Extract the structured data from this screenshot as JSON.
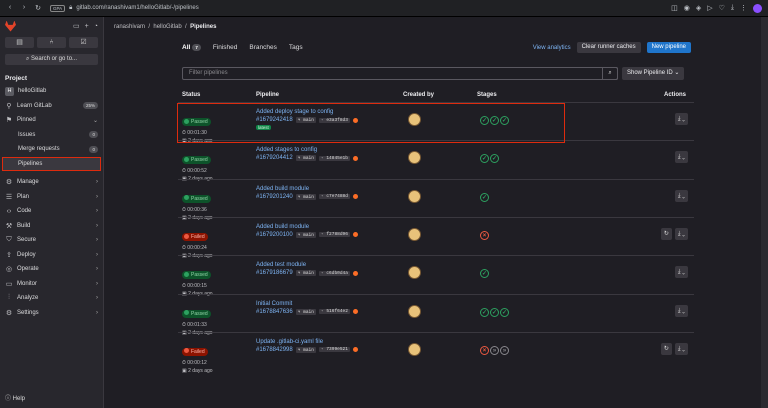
{
  "browser": {
    "security_tag": "GPA",
    "url": "gitlab.com/ranashivam1/helloGitlab/-/pipelines"
  },
  "sidebar": {
    "search": "Search or go to...",
    "section": "Project",
    "project_name": "helloGitlab",
    "project_initial": "H",
    "learn": "Learn GitLab",
    "learn_badge": "25%",
    "pinned": "Pinned",
    "issues": "Issues",
    "issues_count": "0",
    "merge_requests": "Merge requests",
    "mr_count": "0",
    "pipelines": "Pipelines",
    "menu": [
      "Manage",
      "Plan",
      "Code",
      "Build",
      "Secure",
      "Deploy",
      "Operate",
      "Monitor",
      "Analyze",
      "Settings"
    ],
    "help": "Help"
  },
  "breadcrumb": {
    "user": "ranashivam",
    "project": "helloGitlab",
    "page": "Pipelines"
  },
  "tabs": {
    "all": "All",
    "all_count": "7",
    "finished": "Finished",
    "branches": "Branches",
    "tags": "Tags"
  },
  "actions": {
    "analytics": "View analytics",
    "clear": "Clear runner caches",
    "new": "New pipeline"
  },
  "filter": {
    "placeholder": "Filter pipelines",
    "show_id": "Show Pipeline ID"
  },
  "columns": {
    "status": "Status",
    "pipeline": "Pipeline",
    "created_by": "Created by",
    "stages": "Stages",
    "actions": "Actions"
  },
  "rows": [
    {
      "status": "Passed",
      "duration": "00:01:30",
      "ago": "2 days ago",
      "title": "Added deploy stage to config",
      "id": "#1679242418",
      "branch": "main",
      "commit": "e3a3f8d3",
      "latest": "latest"
    },
    {
      "status": "Passed",
      "duration": "00:00:52",
      "ago": "2 days ago",
      "title": "Added stages to config",
      "id": "#1679204412",
      "branch": "main",
      "commit": "14845e1b"
    },
    {
      "status": "Passed",
      "duration": "00:00:36",
      "ago": "2 days ago",
      "title": "Added build module",
      "id": "#1679201240",
      "branch": "main",
      "commit": "c7e7488d"
    },
    {
      "status": "Failed",
      "duration": "00:00:24",
      "ago": "2 days ago",
      "title": "Added build module",
      "id": "#1679200100",
      "branch": "main",
      "commit": "f2788d96"
    },
    {
      "status": "Passed",
      "duration": "00:00:15",
      "ago": "2 days ago",
      "title": "Added test module",
      "id": "#1679186679",
      "branch": "main",
      "commit": "c6db0d4a"
    },
    {
      "status": "Passed",
      "duration": "00:01:33",
      "ago": "2 days ago",
      "title": "Initial Commit",
      "id": "#1678847636",
      "branch": "main",
      "commit": "516f64e2"
    },
    {
      "status": "Failed",
      "duration": "00:00:12",
      "ago": "2 days ago",
      "title": "Update .gitlab-ci.yaml file",
      "id": "#1678842998",
      "branch": "main",
      "commit": "7399e521"
    }
  ]
}
